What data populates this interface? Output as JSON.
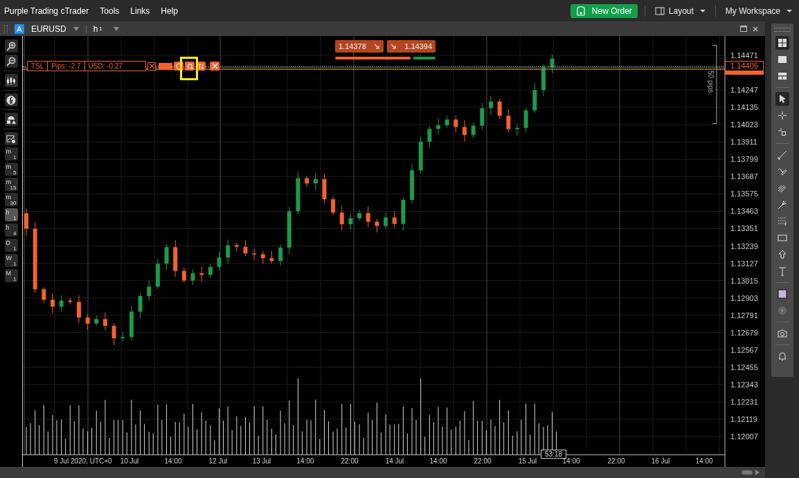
{
  "menu": [
    "Purple Trading cTrader",
    "Tools",
    "Links",
    "Help"
  ],
  "actions": {
    "new_order": "New Order",
    "layout": "Layout",
    "workspace": "My Workspace"
  },
  "chart_header": {
    "badge": "A",
    "symbol": "EURUSD",
    "timeframe_unit": "h",
    "timeframe_count": "1"
  },
  "timeframes": [
    {
      "unit": "m",
      "count": "1",
      "selected": false
    },
    {
      "unit": "m",
      "count": "5",
      "selected": false
    },
    {
      "unit": "m",
      "count": "15",
      "selected": false
    },
    {
      "unit": "m",
      "count": "30",
      "selected": false
    },
    {
      "unit": "h",
      "count": "1",
      "selected": true
    },
    {
      "unit": "h",
      "count": "4",
      "selected": false
    },
    {
      "unit": "D",
      "count": "1",
      "selected": false
    },
    {
      "unit": "W",
      "count": "1",
      "selected": false
    },
    {
      "unit": "M",
      "count": "1",
      "selected": false
    }
  ],
  "quotes": {
    "sell": "1.14378",
    "buy": "1.14394",
    "sentiment": {
      "level": 0.75
    }
  },
  "order_label": {
    "type": "TSL",
    "pips": "Pips: -2.7",
    "usd": "USD: -0.27"
  },
  "price_axis": [
    "1.14471",
    "1.14247",
    "1.14135",
    "1.14023",
    "1.13911",
    "1.13799",
    "1.13687",
    "1.13575",
    "1.13463",
    "1.13351",
    "1.13239",
    "1.13127",
    "1.13015",
    "1.12903",
    "1.12791",
    "1.12679",
    "1.12567",
    "1.12455",
    "1.12343",
    "1.12231",
    "1.12119",
    "1.12007"
  ],
  "current_price": "1.14405",
  "pip_ruler": "50 pips",
  "countdown": "53:18",
  "time_axis": [
    "9 Jul 2020, UTC+0",
    "10 Jul",
    "14:00",
    "12 Jul",
    "13 Jul",
    "14:00",
    "22:00",
    "14 Jul",
    "14:00",
    "22:00",
    "15 Jul",
    "14:00",
    "22:00",
    "16 Jul",
    "14:00"
  ],
  "right_toolbar": [
    [
      {
        "kind": "grid",
        "selected": true
      },
      {
        "kind": "single",
        "selected": false
      },
      {
        "kind": "split",
        "selected": false
      }
    ],
    [
      {
        "kind": "pointer",
        "selected": true
      },
      {
        "kind": "crosshair",
        "selected": false
      },
      {
        "kind": "crossbox",
        "selected": false
      }
    ],
    [
      {
        "kind": "line",
        "selected": false
      },
      {
        "kind": "pen",
        "selected": false
      },
      {
        "kind": "fan",
        "selected": false
      },
      {
        "kind": "fork",
        "selected": false
      },
      {
        "kind": "dots",
        "selected": false
      },
      {
        "kind": "rect",
        "selected": false
      },
      {
        "kind": "arrow",
        "selected": false
      },
      {
        "kind": "text",
        "selected": false
      }
    ],
    [
      {
        "kind": "swatch",
        "selected": false,
        "color": "#c9b4e2"
      },
      {
        "kind": "circle",
        "selected": false
      }
    ],
    [
      {
        "kind": "camera",
        "selected": false
      }
    ],
    [
      {
        "kind": "bell",
        "selected": false
      }
    ]
  ]
}
